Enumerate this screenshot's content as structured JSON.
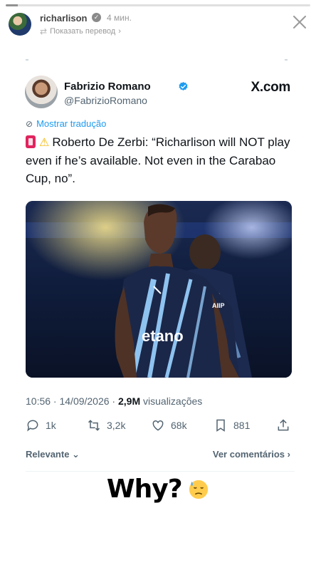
{
  "story": {
    "username": "richarlison",
    "time": "4 мин.",
    "translate_label": "Показать перевод",
    "translate_chevron": "›",
    "close_icon": "close-icon",
    "progress": 0.04
  },
  "tweet": {
    "author_name": "Fabrizio Romano",
    "author_handle": "@FabrizioRomano",
    "source": "X.com",
    "show_translation": "Mostrar tradução",
    "text": "Roberto De Zerbi: “Richarlison will NOT play even if he’s available. Not even in the Carabao Cup, no”.",
    "timestamp": "10:56 · 14/09/2026 · ",
    "views": "2,9M",
    "views_label": " visualizações",
    "replies": "1k",
    "reposts": "3,2k",
    "likes": "68k",
    "bookmarks": "881",
    "filter_label": "Relevante",
    "see_comments": "Ver comentários",
    "brand_color": "#1d9bf0"
  },
  "caption": {
    "text": "Why?",
    "emoji": "downcast-sweat-face"
  }
}
